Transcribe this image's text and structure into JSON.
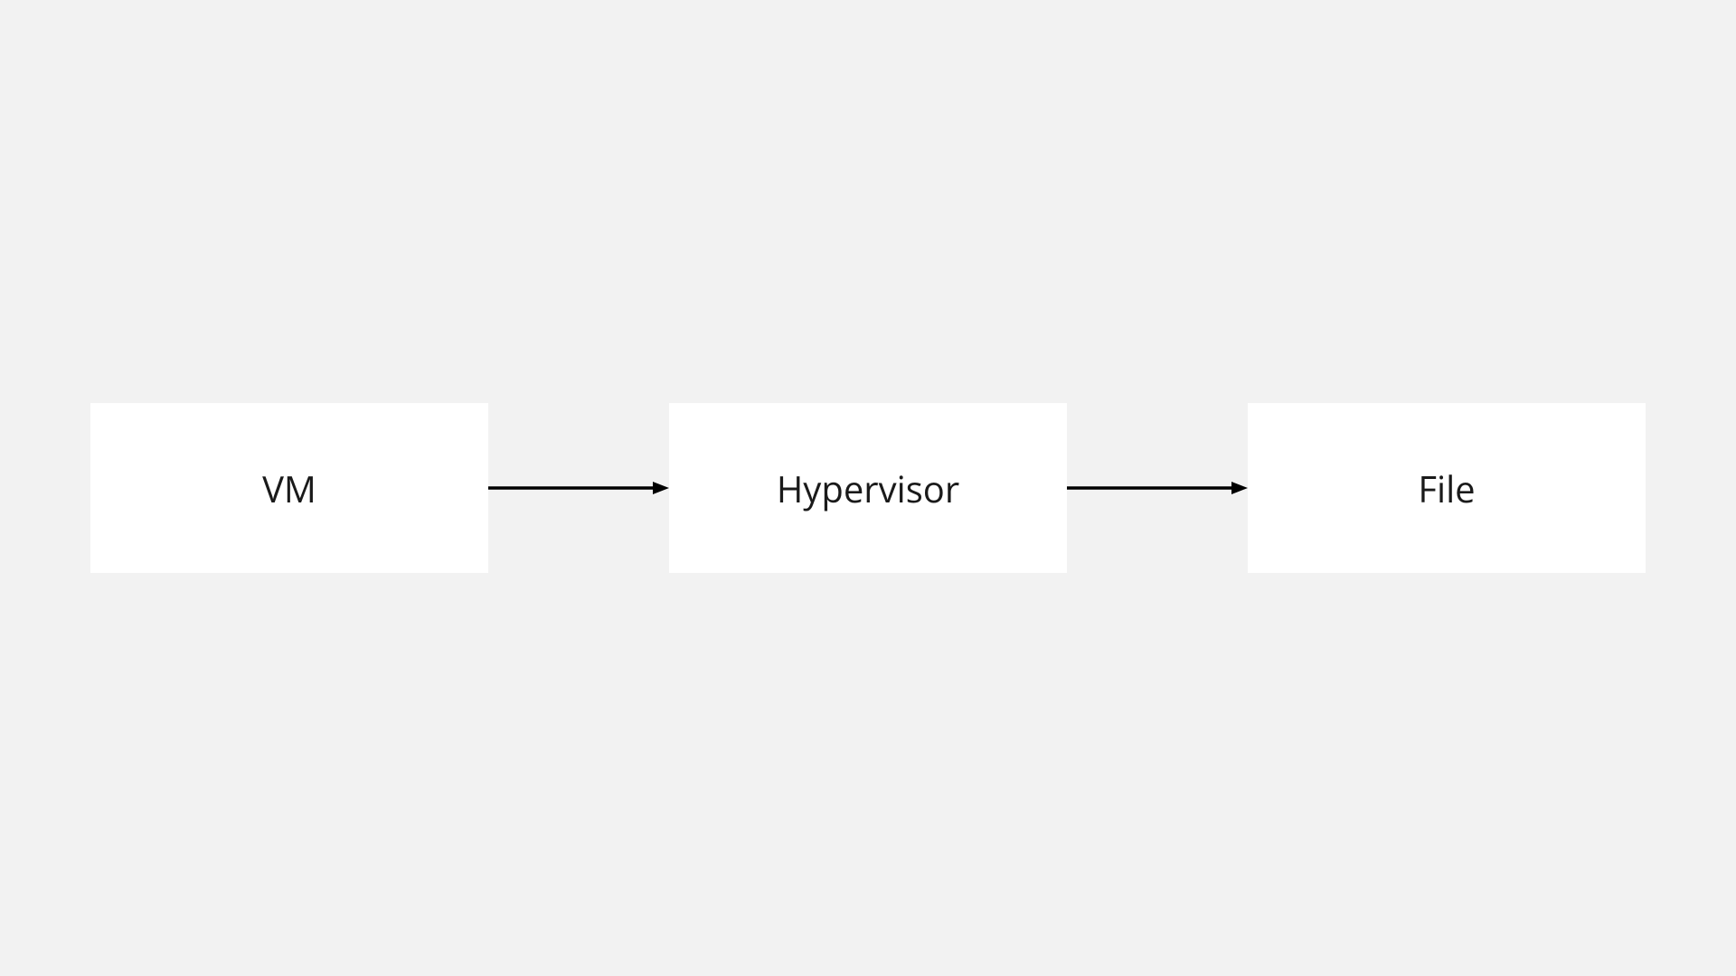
{
  "diagram": {
    "nodes": [
      {
        "label": "VM"
      },
      {
        "label": "Hypervisor"
      },
      {
        "label": "File"
      }
    ]
  }
}
